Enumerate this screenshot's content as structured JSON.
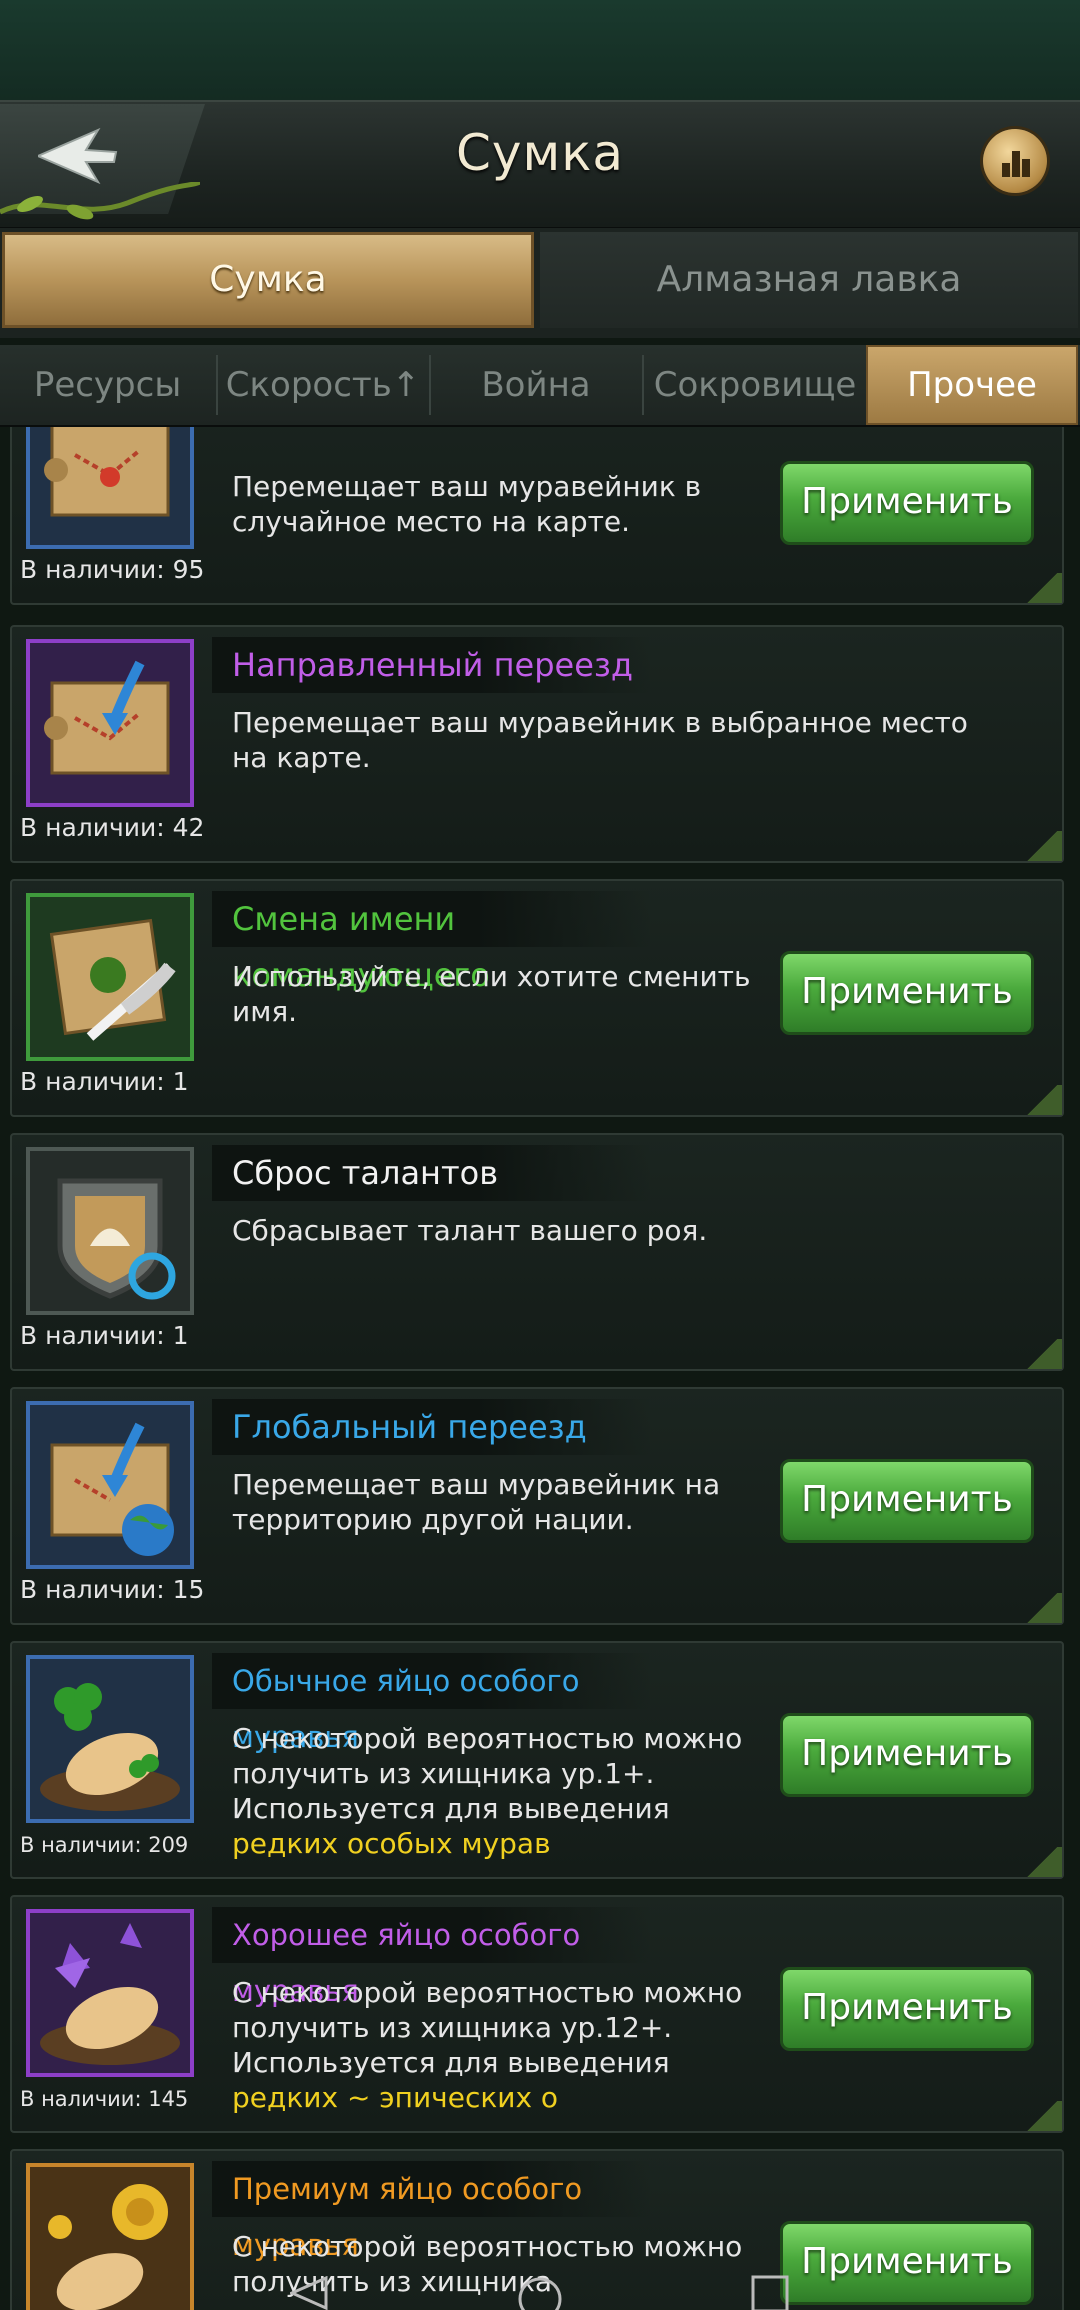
{
  "header": {
    "title": "Сумка"
  },
  "tabs": {
    "bag": "Сумка",
    "shop": "Алмазная лавка"
  },
  "subtabs": [
    "Ресурсы",
    "Скорость↑",
    "Война",
    "Сокровище",
    "Прочее"
  ],
  "apply_label": "Применить",
  "items": [
    {
      "name": "",
      "desc": "Перемещает ваш муравейник в случайное место на карте.",
      "stock": "В наличии: 95",
      "color": "#39a8e8",
      "has_apply": true
    },
    {
      "name": "Направленный переезд",
      "desc": "Перемещает ваш муравейник в выбранное место на карте.",
      "stock": "В наличии: 42",
      "color": "#c15ee8",
      "has_apply": false
    },
    {
      "name": "Смена имени командующего",
      "desc": "Используйте, если хотите сменить имя.",
      "stock": "В наличии: 1",
      "color": "#52c43e",
      "has_apply": true
    },
    {
      "name": "Сброс талантов",
      "desc": "Сбрасывает талант вашего роя.",
      "stock": "В наличии: 1",
      "color": "#f2f2f2",
      "has_apply": false
    },
    {
      "name": "Глобальный переезд",
      "desc": "Перемещает ваш муравейник на территорию другой нации.",
      "stock": "В наличии: 15",
      "color": "#39a8e8",
      "has_apply": true
    },
    {
      "name": "Обычное яйцо особого муравья",
      "desc": "С некоторой вероятностью можно получить из хищника ур.1+. Используется для выведения ",
      "desc_highlight": "редких особых мурав",
      "stock": "В наличии: 209",
      "color": "#39a8e8",
      "has_apply": true
    },
    {
      "name": "Хорошее яйцо особого муравья",
      "desc": "С некоторой вероятностью можно получить из хищника ур.12+. Используется для выведения ",
      "desc_highlight": "редких ~ эпических о",
      "stock": "В наличии: 145",
      "color": "#c15ee8",
      "has_apply": true
    },
    {
      "name": "Премиум яйцо особого муравья",
      "desc": "С некоторой вероятностью можно получить из хищника",
      "stock": "",
      "color": "#f09a22",
      "has_apply": true
    }
  ]
}
